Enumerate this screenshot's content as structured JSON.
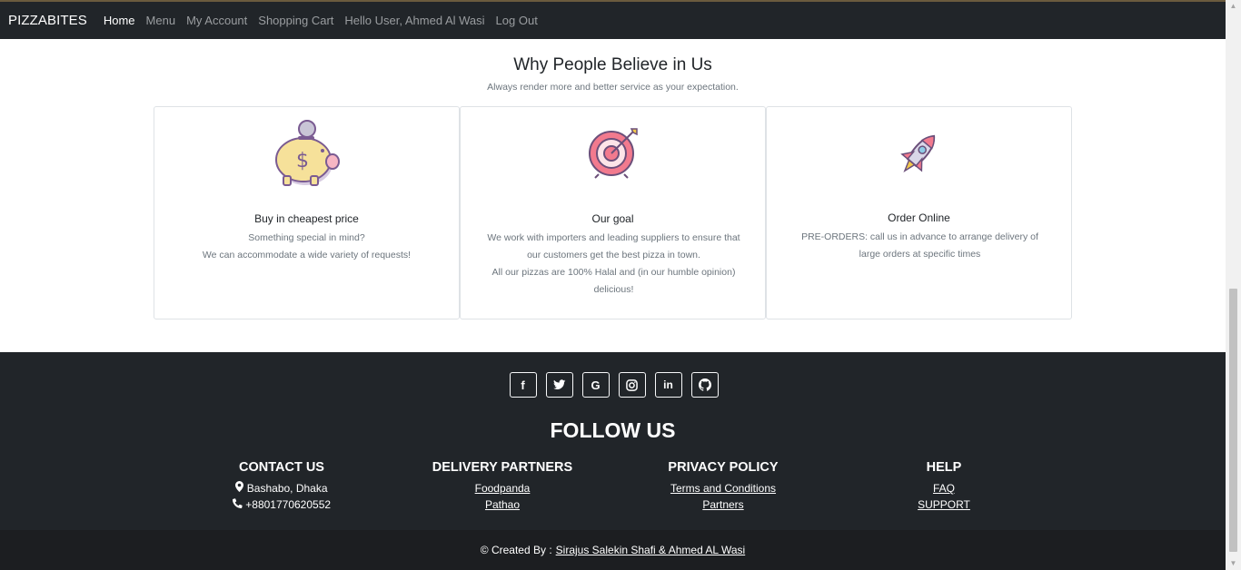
{
  "nav": {
    "brand": "PIZZABITES",
    "links": [
      "Home",
      "Menu",
      "My Account",
      "Shopping Cart",
      "Hello User, Ahmed Al Wasi",
      "Log Out"
    ]
  },
  "why": {
    "title": "Why People Believe in Us",
    "subtitle": "Always render more and better service as your expectation.",
    "cards": [
      {
        "icon": "piggy-bank-icon",
        "title": "Buy in cheapest price",
        "lines": [
          "Something special in mind?",
          "We can accommodate a wide variety of requests!"
        ]
      },
      {
        "icon": "target-icon",
        "title": "Our goal",
        "lines": [
          "We work with importers and leading suppliers to ensure that our customers get the best pizza in town.",
          "All our pizzas are 100% Halal and (in our humble opinion) delicious!"
        ]
      },
      {
        "icon": "rocket-icon",
        "title": "Order Online",
        "lines": [
          "PRE-ORDERS: call us in advance to arrange delivery of large orders at specific times"
        ]
      }
    ]
  },
  "footer": {
    "socials": [
      "facebook-icon",
      "twitter-icon",
      "google-icon",
      "instagram-icon",
      "linkedin-icon",
      "github-icon"
    ],
    "follow": "FOLLOW US",
    "contact": {
      "title": "CONTACT US",
      "address": "Bashabo, Dhaka",
      "phone": "+8801770620552"
    },
    "delivery": {
      "title": "DELIVERY PARTNERS",
      "items": [
        "Foodpanda",
        "Pathao"
      ]
    },
    "privacy": {
      "title": "PRIVACY POLICY",
      "items": [
        "Terms and Conditions",
        "Partners"
      ]
    },
    "help": {
      "title": "HELP",
      "items": [
        "FAQ",
        "SUPPORT"
      ]
    },
    "copyright_prefix": "© Created By :",
    "copyright_authors": "Sirajus Salekin Shafi & Ahmed AL Wasi"
  }
}
